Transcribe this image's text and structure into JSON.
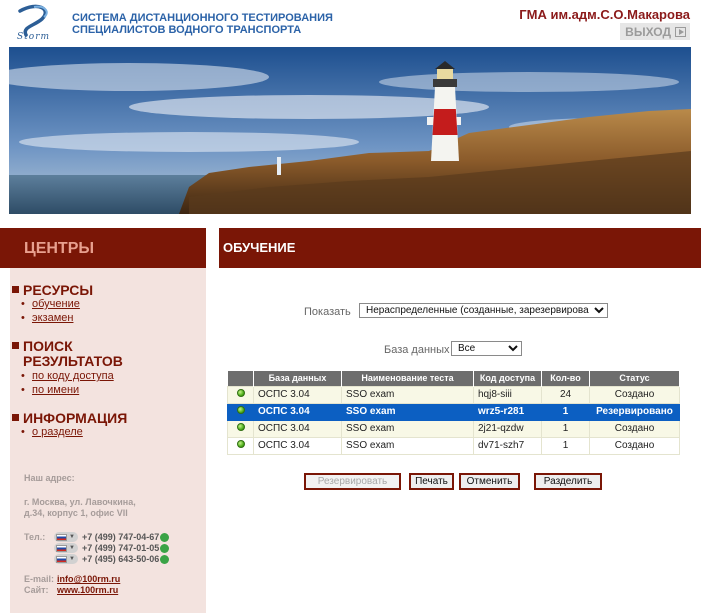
{
  "header": {
    "logo_text": "Storm",
    "system_title_line1": "СИСТЕМА ДИСТАНЦИОННОГО ТЕСТИРОВАНИЯ",
    "system_title_line2": "СПЕЦИАЛИСТОВ ВОДНОГО ТРАНСПОРТА",
    "organization": "ГМА им.адм.С.О.Макарова",
    "logout_label": "ВЫХОД"
  },
  "sidebar": {
    "title": "ЦЕНТРЫ",
    "sections": [
      {
        "title_lines": [
          "РЕСУРСЫ"
        ],
        "links": [
          "обучение",
          "экзамен"
        ]
      },
      {
        "title_lines": [
          "ПОИСК",
          "РЕЗУЛЬТАТОВ"
        ],
        "links": [
          "по коду доступа",
          "по имени"
        ]
      },
      {
        "title_lines": [
          "ИНФОРМАЦИЯ"
        ],
        "links": [
          "о разделе"
        ]
      }
    ],
    "contacts": {
      "address_label": "Наш адрес:",
      "address_line1": "г. Москва, ул. Лавочкина,",
      "address_line2": "д.34, корпус 1, офис VII",
      "phone_label": "Тел.:",
      "phones": [
        "+7 (499) 747-04-67",
        "+7 (499) 747-01-05",
        "+7 (495) 643-50-06"
      ],
      "email_label": "E-mail:",
      "email": "info@100rm.ru",
      "site_label": "Сайт:",
      "site": "www.100rm.ru"
    }
  },
  "main": {
    "title": "ОБУЧЕНИЕ",
    "filters": {
      "show_label": "Показать",
      "show_value": "Нераспределенные (созданные, зарезервированные)",
      "db_label": "База данных",
      "db_value": "Все"
    },
    "table": {
      "columns": [
        "",
        "База данных",
        "Наименование теста",
        "Код доступа",
        "Кол-во",
        "Статус"
      ],
      "rows": [
        {
          "db": "ОСПС 3.04",
          "test": "SSO exam",
          "code": "hqj8-siii",
          "qty": "24",
          "status": "Создано",
          "selected": false
        },
        {
          "db": "ОСПС 3.04",
          "test": "SSO exam",
          "code": "wrz5-r281",
          "qty": "1",
          "status": "Резервировано",
          "selected": true
        },
        {
          "db": "ОСПС 3.04",
          "test": "SSO exam",
          "code": "2j21-qzdw",
          "qty": "1",
          "status": "Создано",
          "selected": false
        },
        {
          "db": "ОСПС 3.04",
          "test": "SSO exam",
          "code": "dv71-szh7",
          "qty": "1",
          "status": "Создано",
          "selected": false
        }
      ]
    },
    "buttons": {
      "reserve": "Резервировать",
      "print": "Печать",
      "cancel": "Отменить",
      "split": "Разделить"
    }
  },
  "colors": {
    "accent_dark_red": "#7a1606",
    "title_blue": "#2c63a8",
    "selected_row": "#0c5fc2",
    "sidebar_bg": "#f3e3df"
  }
}
